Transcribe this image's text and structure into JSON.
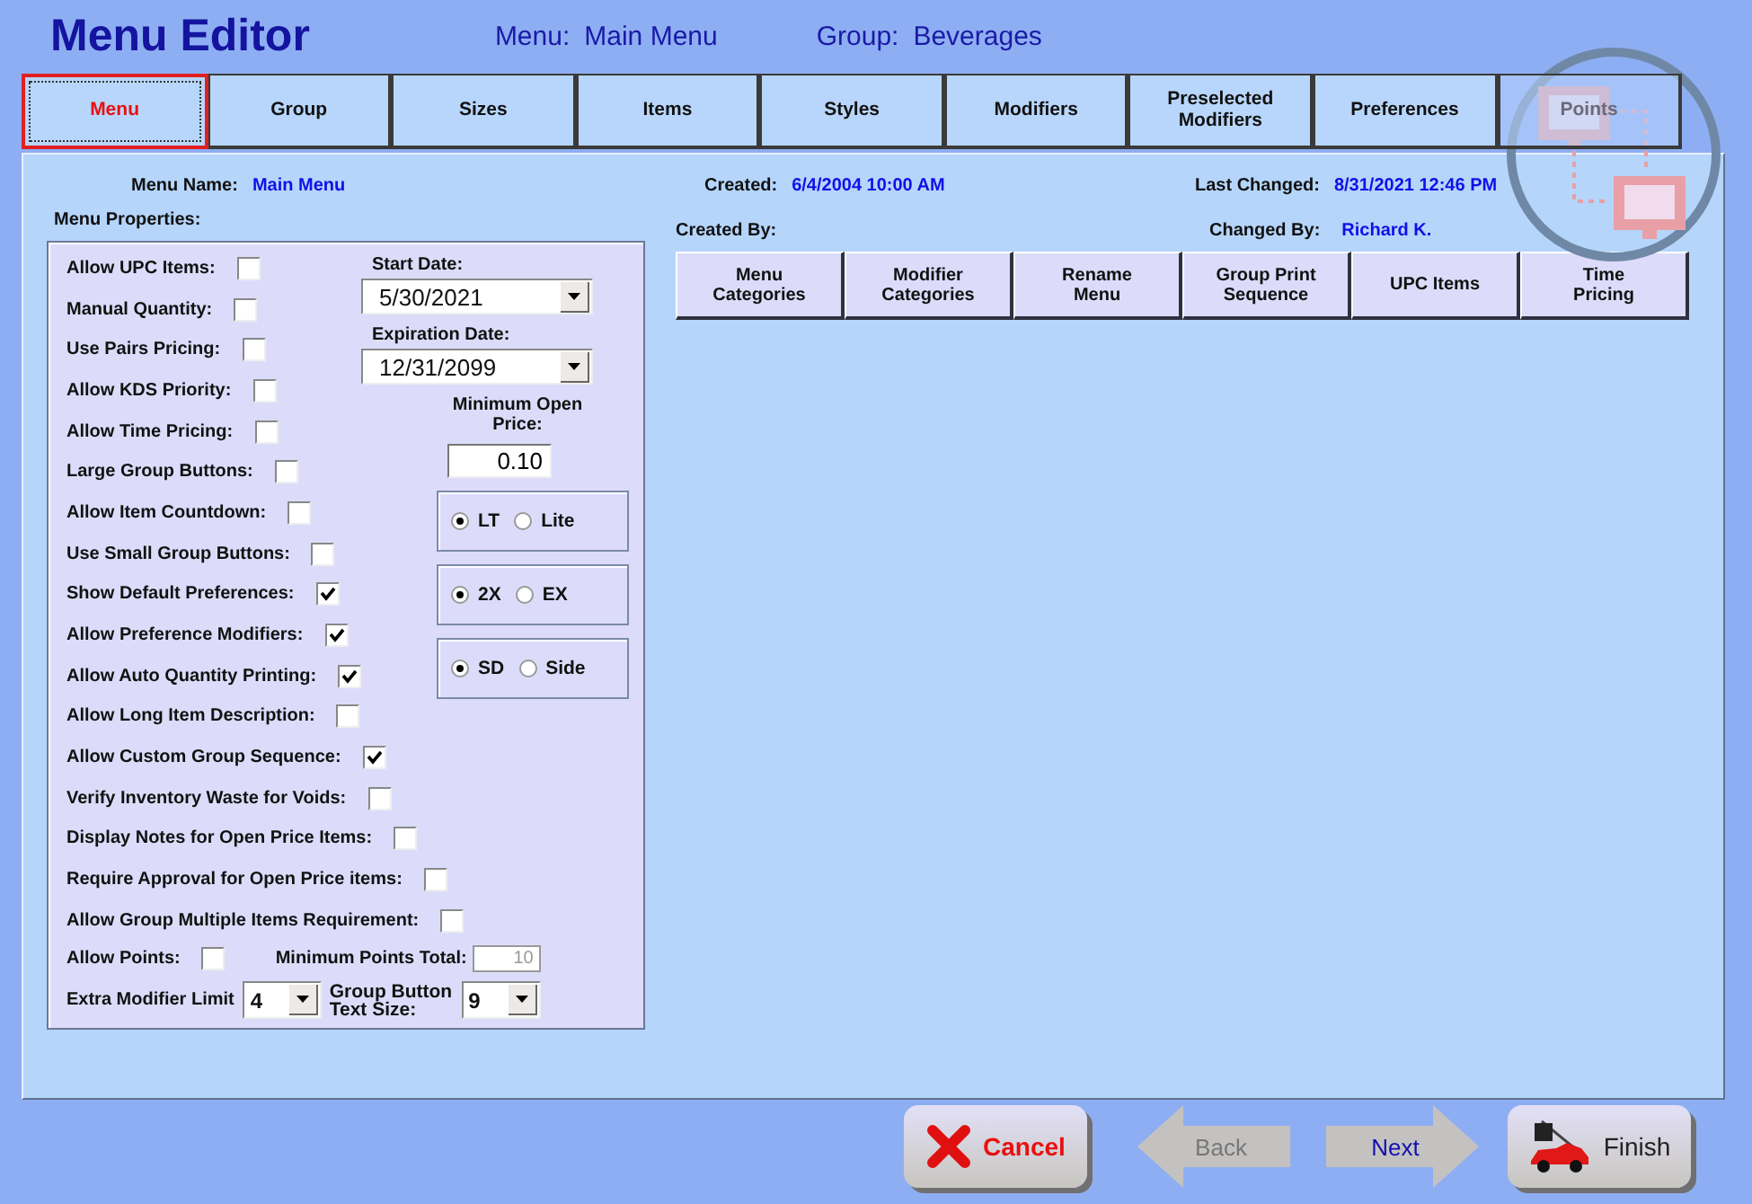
{
  "window": {
    "title": "Menu Editor"
  },
  "header": {
    "menu_label": "Menu:",
    "menu_value": "Main Menu",
    "group_label": "Group:",
    "group_value": "Beverages"
  },
  "tabs": [
    {
      "lines": [
        "Menu"
      ],
      "selected": true,
      "disabled": false
    },
    {
      "lines": [
        "Group"
      ],
      "selected": false,
      "disabled": false
    },
    {
      "lines": [
        "Sizes"
      ],
      "selected": false,
      "disabled": false
    },
    {
      "lines": [
        "Items"
      ],
      "selected": false,
      "disabled": false
    },
    {
      "lines": [
        "Styles"
      ],
      "selected": false,
      "disabled": false
    },
    {
      "lines": [
        "Modifiers"
      ],
      "selected": false,
      "disabled": false
    },
    {
      "lines": [
        "Preselected",
        "Modifiers"
      ],
      "selected": false,
      "disabled": false
    },
    {
      "lines": [
        "Preferences"
      ],
      "selected": false,
      "disabled": false
    },
    {
      "lines": [
        "Points"
      ],
      "selected": false,
      "disabled": true
    }
  ],
  "info": [
    {
      "label": "Menu Name:",
      "value": "Main Menu"
    },
    {
      "label": "Created:",
      "value": "6/4/2004 10:00 AM"
    },
    {
      "label": "Last Changed:",
      "value": "8/31/2021 12:46 PM"
    }
  ],
  "properties_title": "Menu Properties:",
  "created_by": {
    "label": "Created By:"
  },
  "changed_by": {
    "label": "Changed By:",
    "value": "Richard K."
  },
  "action_buttons": [
    {
      "lines": [
        "Menu",
        "Categories"
      ]
    },
    {
      "lines": [
        "Modifier",
        "Categories"
      ]
    },
    {
      "lines": [
        "Rename",
        "Menu"
      ]
    },
    {
      "lines": [
        "Group Print",
        "Sequence"
      ]
    },
    {
      "lines": [
        "UPC Items"
      ]
    },
    {
      "lines": [
        "Time",
        "Pricing"
      ]
    }
  ],
  "top_options": [
    {
      "label": "Allow UPC Items:",
      "checked": false
    },
    {
      "label": "Manual Quantity:",
      "checked": false
    },
    {
      "label": "Use Pairs Pricing:",
      "checked": false
    },
    {
      "label": "Allow KDS Priority:",
      "checked": false
    },
    {
      "label": "Allow Time Pricing:",
      "checked": false
    },
    {
      "label": "Large Group Buttons:",
      "checked": false
    },
    {
      "label": "Allow Item Countdown:",
      "checked": false
    },
    {
      "label": "Use Small Group Buttons:",
      "checked": false
    },
    {
      "label": "Show Default Preferences:",
      "checked": true
    },
    {
      "label": "Allow Preference Modifiers:",
      "checked": true
    },
    {
      "label": "Allow Auto Quantity Printing:",
      "checked": true
    },
    {
      "label": "Allow Long Item Description:",
      "checked": false
    }
  ],
  "wide_options": [
    {
      "label": "Allow Custom Group Sequence:",
      "checked": true
    },
    {
      "label": "Verify Inventory Waste for Voids:",
      "checked": false
    },
    {
      "label": "Display Notes for Open Price Items:",
      "checked": false
    },
    {
      "label": "Require Approval for Open Price items:",
      "checked": false
    },
    {
      "label": "Allow Group Multiple Items Requirement:",
      "checked": false
    }
  ],
  "start_date": {
    "label": "Start Date:",
    "value": "5/30/2021"
  },
  "expiration_date": {
    "label": "Expiration Date:",
    "value": "12/31/2099"
  },
  "min_open_price": {
    "lines": [
      "Minimum Open",
      "Price:"
    ],
    "value": "0.10"
  },
  "radio_groups": [
    [
      {
        "label": "LT",
        "selected": true
      },
      {
        "label": "Lite",
        "selected": false
      }
    ],
    [
      {
        "label": "2X",
        "selected": true
      },
      {
        "label": "EX",
        "selected": false
      }
    ],
    [
      {
        "label": "SD",
        "selected": true
      },
      {
        "label": "Side",
        "selected": false
      }
    ]
  ],
  "allow_points": {
    "label": "Allow Points:",
    "checked": false
  },
  "min_points_total": {
    "label": "Minimum Points Total:",
    "value": "10",
    "disabled": true
  },
  "extra_modifier_limit": {
    "label": "Extra Modifier Limit",
    "value": "4"
  },
  "group_button_text_size": {
    "lines": [
      "Group Button",
      "Text Size:"
    ],
    "value": "9"
  },
  "footer_buttons": [
    {
      "kind": "cancel",
      "label": "Cancel",
      "disabled": false
    },
    {
      "kind": "back",
      "label": "Back",
      "disabled": true
    },
    {
      "kind": "next",
      "label": "Next",
      "disabled": false
    },
    {
      "kind": "finish",
      "label": "Finish",
      "disabled": false
    }
  ]
}
